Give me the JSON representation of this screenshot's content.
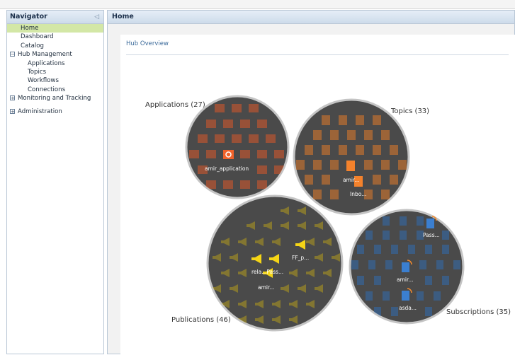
{
  "navigator": {
    "title": "Navigator",
    "collapse_glyph": "◁",
    "items": [
      {
        "label": "Home",
        "type": "item",
        "active": true
      },
      {
        "label": "Dashboard",
        "type": "item"
      },
      {
        "label": "Catalog",
        "type": "item"
      },
      {
        "label": "Hub Management",
        "type": "group",
        "expander": "⊟"
      },
      {
        "label": "Applications",
        "type": "sub"
      },
      {
        "label": "Topics",
        "type": "sub"
      },
      {
        "label": "Workflows",
        "type": "sub"
      },
      {
        "label": "Connections",
        "type": "sub"
      },
      {
        "label": "Monitoring and Tracking",
        "type": "group",
        "expander": "⊞"
      },
      {
        "label": "Administration",
        "type": "group",
        "expander": "⊞"
      }
    ]
  },
  "main": {
    "title": "Home",
    "section_title": "Hub Overview"
  },
  "hub_overview": {
    "applications": {
      "label": "Applications (27)",
      "icon": "gear-app-icon",
      "color": "#e8622c",
      "item_labels": [
        "amir_application"
      ]
    },
    "topics": {
      "label": "Topics (33)",
      "icon": "topic-icon",
      "color": "#f28a2e",
      "item_labels": [
        "amir...",
        "Inbo..."
      ]
    },
    "publications": {
      "label": "Publications (46)",
      "icon": "megaphone-icon",
      "color": "#f5d516",
      "item_labels": [
        "FF_p...",
        "rela...Pass...",
        "amir..."
      ]
    },
    "subscriptions": {
      "label": "Subscriptions (35)",
      "icon": "document-rss-icon",
      "color": "#3b7fd0",
      "item_labels": [
        "Pass...",
        "amir...",
        "asda..."
      ]
    },
    "circle_color": "#4a4a4a",
    "circle_border": "#c4c4c4"
  }
}
